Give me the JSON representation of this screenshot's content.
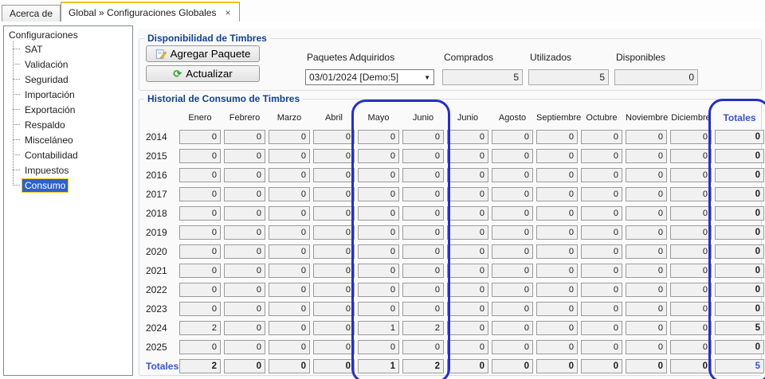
{
  "icons": {
    "close": "×",
    "dropdown": "▼",
    "refresh": "⟳"
  },
  "colors": {
    "accent_gold": "#f2c211",
    "selection_blue": "#2e62c8",
    "title_navy": "#14418e",
    "totales_blue": "#3a52cc",
    "annotation_blue": "#2531c2"
  },
  "tabs": [
    {
      "label": "Acerca de",
      "active": false
    },
    {
      "label": "Global » Configuraciones Globales",
      "active": true,
      "closable": true
    }
  ],
  "sidebar": {
    "root": "Configuraciones",
    "items": [
      "SAT",
      "Validación",
      "Seguridad",
      "Importación",
      "Exportación",
      "Respaldo",
      "Misceláneo",
      "Contabilidad",
      "Impuestos",
      "Consumo"
    ],
    "selected": "Consumo"
  },
  "availability": {
    "title": "Disponibilidad de Timbres",
    "add_button": "Agregar Paquete",
    "refresh_button": "Actualizar",
    "packages_label": "Paquetes Adquiridos",
    "packages_value": "03/01/2024 [Demo:5]",
    "fields": [
      {
        "label": "Comprados",
        "value": "5"
      },
      {
        "label": "Utilizados",
        "value": "5"
      },
      {
        "label": "Disponibles",
        "value": "0"
      }
    ]
  },
  "history": {
    "title": "Historial de Consumo de Timbres",
    "months": [
      "Enero",
      "Febrero",
      "Marzo",
      "Abril",
      "Mayo",
      "Junio",
      "Junio",
      "Agosto",
      "Septiembre",
      "Octubre",
      "Noviembre",
      "Diciembre"
    ],
    "totals_column": "Totales",
    "rows": [
      {
        "year": "2014",
        "values": [
          "0",
          "0",
          "0",
          "0",
          "0",
          "0",
          "0",
          "0",
          "0",
          "0",
          "0",
          "0"
        ],
        "total": "0"
      },
      {
        "year": "2015",
        "values": [
          "0",
          "0",
          "0",
          "0",
          "0",
          "0",
          "0",
          "0",
          "0",
          "0",
          "0",
          "0"
        ],
        "total": "0"
      },
      {
        "year": "2016",
        "values": [
          "0",
          "0",
          "0",
          "0",
          "0",
          "0",
          "0",
          "0",
          "0",
          "0",
          "0",
          "0"
        ],
        "total": "0"
      },
      {
        "year": "2017",
        "values": [
          "0",
          "0",
          "0",
          "0",
          "0",
          "0",
          "0",
          "0",
          "0",
          "0",
          "0",
          "0"
        ],
        "total": "0"
      },
      {
        "year": "2018",
        "values": [
          "0",
          "0",
          "0",
          "0",
          "0",
          "0",
          "0",
          "0",
          "0",
          "0",
          "0",
          "0"
        ],
        "total": "0"
      },
      {
        "year": "2019",
        "values": [
          "0",
          "0",
          "0",
          "0",
          "0",
          "0",
          "0",
          "0",
          "0",
          "0",
          "0",
          "0"
        ],
        "total": "0"
      },
      {
        "year": "2020",
        "values": [
          "0",
          "0",
          "0",
          "0",
          "0",
          "0",
          "0",
          "0",
          "0",
          "0",
          "0",
          "0"
        ],
        "total": "0"
      },
      {
        "year": "2021",
        "values": [
          "0",
          "0",
          "0",
          "0",
          "0",
          "0",
          "0",
          "0",
          "0",
          "0",
          "0",
          "0"
        ],
        "total": "0"
      },
      {
        "year": "2022",
        "values": [
          "0",
          "0",
          "0",
          "0",
          "0",
          "0",
          "0",
          "0",
          "0",
          "0",
          "0",
          "0"
        ],
        "total": "0"
      },
      {
        "year": "2023",
        "values": [
          "0",
          "0",
          "0",
          "0",
          "0",
          "0",
          "0",
          "0",
          "0",
          "0",
          "0",
          "0"
        ],
        "total": "0"
      },
      {
        "year": "2024",
        "values": [
          "2",
          "0",
          "0",
          "0",
          "1",
          "2",
          "0",
          "0",
          "0",
          "0",
          "0",
          "0"
        ],
        "total": "5"
      },
      {
        "year": "2025",
        "values": [
          "0",
          "0",
          "0",
          "0",
          "0",
          "0",
          "0",
          "0",
          "0",
          "0",
          "0",
          "0"
        ],
        "total": "0"
      }
    ],
    "totals_row": {
      "label": "Totales",
      "values": [
        "2",
        "0",
        "0",
        "0",
        "1",
        "2",
        "0",
        "0",
        "0",
        "0",
        "0",
        "0"
      ],
      "total": "5"
    },
    "annotated_columns": [
      "Mayo",
      "Junio",
      "Totales"
    ]
  }
}
